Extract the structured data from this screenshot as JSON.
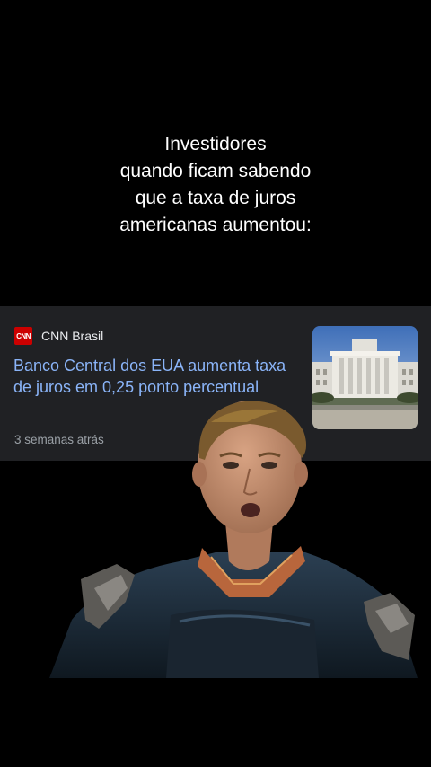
{
  "caption": {
    "text": "Investidores\nquando ficam sabendo\nque a taxa de juros\namericanas aumentou:"
  },
  "news": {
    "logo_text": "CNN",
    "source": "CNN Brasil",
    "headline": "Banco Central dos EUA aumenta taxa de juros em 0,25 ponto percentual",
    "time_ago": "3 semanas atrás",
    "thumbnail_icon": "federal-reserve-building-photo"
  },
  "overlay": {
    "icon": "shocked-man-photo"
  },
  "colors": {
    "background": "#000000",
    "card": "#202124",
    "headline": "#8ab4f8",
    "source": "#e8eaed",
    "time": "#9aa0a6",
    "cnn_red": "#cc0000"
  }
}
